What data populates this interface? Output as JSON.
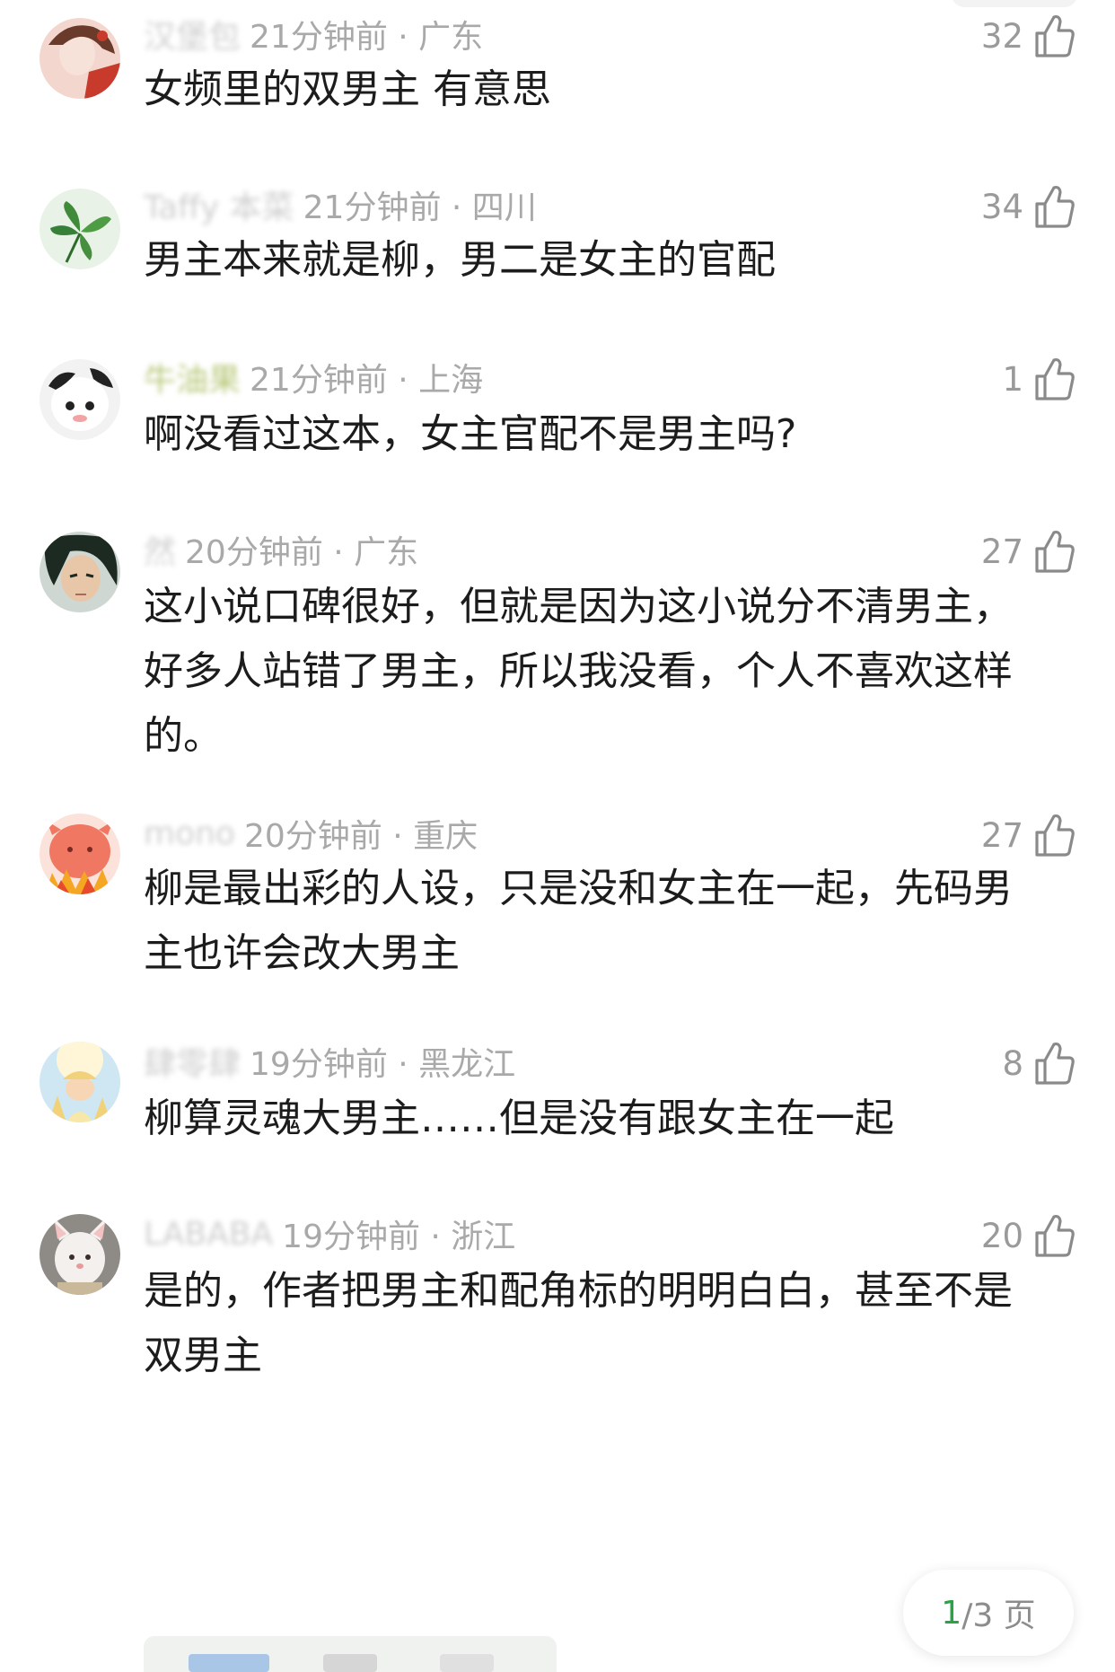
{
  "comments": [
    {
      "username": "汉堡包",
      "time_location": "21分钟前 · 广东",
      "likes": "32",
      "text": "女频里的双男主 有意思",
      "avatar_colors": [
        "#f3d7cf",
        "#c83a2c"
      ]
    },
    {
      "username": "Taffy 本菜",
      "time_location": "21分钟前 · 四川",
      "likes": "34",
      "text": "男主本来就是柳，男二是女主的官配",
      "avatar_colors": [
        "#e9f2e6",
        "#3f8b3a"
      ]
    },
    {
      "username": "牛油果",
      "time_location": "21分钟前 · 上海",
      "likes": "1",
      "text": "啊没看过这本，女主官配不是男主吗?",
      "avatar_colors": [
        "#f2f2f2",
        "#222222"
      ]
    },
    {
      "username": "然",
      "time_location": "20分钟前 · 广东",
      "likes": "27",
      "text": "这小说口碑很好，但就是因为这小说分不清男主，好多人站错了男主，所以我没看，个人不喜欢这样的。",
      "avatar_colors": [
        "#e8c7a8",
        "#1d2a22"
      ]
    },
    {
      "username": "mono",
      "time_location": "20分钟前 · 重庆",
      "likes": "27",
      "text": "柳是最出彩的人设，只是没和女主在一起，先码男主也许会改大男主",
      "avatar_colors": [
        "#f07762",
        "#e84a2c"
      ]
    },
    {
      "username": "肆零肆",
      "time_location": "19分钟前 · 黑龙江",
      "likes": "8",
      "text": "柳算灵魂大男主……但是没有跟女主在一起",
      "avatar_colors": [
        "#cfe7f3",
        "#f1d27a"
      ]
    },
    {
      "username": "LABABA",
      "time_location": "19分钟前 · 浙江",
      "likes": "20",
      "text": "是的，作者把男主和配角标的明明白白，甚至不是双男主",
      "avatar_colors": [
        "#e8e0dc",
        "#f4f0ee"
      ]
    }
  ],
  "pager": {
    "current": "1",
    "rest": "/3 页"
  },
  "colors": {
    "text": "#1c1c1c",
    "meta": "#a9a9a9",
    "accent": "#2ba245"
  }
}
